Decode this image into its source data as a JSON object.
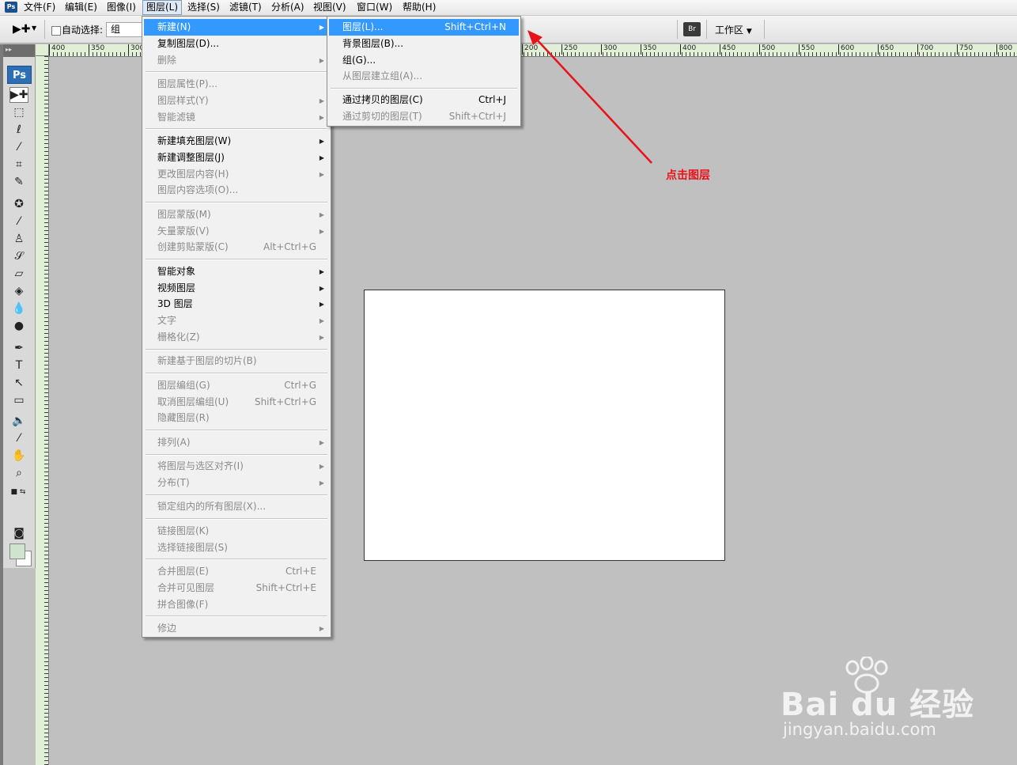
{
  "app": {
    "icon_label": "Ps"
  },
  "menubar": {
    "items": [
      "文件(F)",
      "编辑(E)",
      "图像(I)",
      "图层(L)",
      "选择(S)",
      "滤镜(T)",
      "分析(A)",
      "视图(V)",
      "窗口(W)",
      "帮助(H)"
    ],
    "active": "图层(L)"
  },
  "options_bar": {
    "auto_select_label": "自动选择:",
    "auto_select_checked": false,
    "auto_select_value": "组",
    "bridge_icon_label": "Br",
    "workspace_label": "工作区"
  },
  "toolbox": {
    "logo": "Ps"
  },
  "ruler": {
    "top_ticks": [
      "400",
      "350",
      "300",
      "200",
      "250",
      "300",
      "350",
      "400",
      "450",
      "500",
      "550",
      "600",
      "650",
      "700",
      "750",
      "800"
    ]
  },
  "layer_menu": {
    "items": [
      {
        "label": "新建(N)",
        "shortcut": "",
        "submenu": true,
        "enabled": true,
        "highlighted": true
      },
      {
        "label": "复制图层(D)...",
        "shortcut": "",
        "submenu": false,
        "enabled": true
      },
      {
        "label": "删除",
        "shortcut": "",
        "submenu": true,
        "enabled": false
      },
      {
        "separator": true
      },
      {
        "label": "图层属性(P)...",
        "shortcut": "",
        "submenu": false,
        "enabled": false
      },
      {
        "label": "图层样式(Y)",
        "shortcut": "",
        "submenu": true,
        "enabled": false
      },
      {
        "label": "智能滤镜",
        "shortcut": "",
        "submenu": true,
        "enabled": false
      },
      {
        "separator": true
      },
      {
        "label": "新建填充图层(W)",
        "shortcut": "",
        "submenu": true,
        "enabled": true
      },
      {
        "label": "新建调整图层(J)",
        "shortcut": "",
        "submenu": true,
        "enabled": true
      },
      {
        "label": "更改图层内容(H)",
        "shortcut": "",
        "submenu": true,
        "enabled": false
      },
      {
        "label": "图层内容选项(O)...",
        "shortcut": "",
        "submenu": false,
        "enabled": false
      },
      {
        "separator": true
      },
      {
        "label": "图层蒙版(M)",
        "shortcut": "",
        "submenu": true,
        "enabled": false
      },
      {
        "label": "矢量蒙版(V)",
        "shortcut": "",
        "submenu": true,
        "enabled": false
      },
      {
        "label": "创建剪贴蒙版(C)",
        "shortcut": "Alt+Ctrl+G",
        "submenu": false,
        "enabled": false
      },
      {
        "separator": true
      },
      {
        "label": "智能对象",
        "shortcut": "",
        "submenu": true,
        "enabled": true
      },
      {
        "label": "视频图层",
        "shortcut": "",
        "submenu": true,
        "enabled": true
      },
      {
        "label": "3D 图层",
        "shortcut": "",
        "submenu": true,
        "enabled": true
      },
      {
        "label": "文字",
        "shortcut": "",
        "submenu": true,
        "enabled": false
      },
      {
        "label": "栅格化(Z)",
        "shortcut": "",
        "submenu": true,
        "enabled": false
      },
      {
        "separator": true
      },
      {
        "label": "新建基于图层的切片(B)",
        "shortcut": "",
        "submenu": false,
        "enabled": false
      },
      {
        "separator": true
      },
      {
        "label": "图层编组(G)",
        "shortcut": "Ctrl+G",
        "submenu": false,
        "enabled": false
      },
      {
        "label": "取消图层编组(U)",
        "shortcut": "Shift+Ctrl+G",
        "submenu": false,
        "enabled": false
      },
      {
        "label": "隐藏图层(R)",
        "shortcut": "",
        "submenu": false,
        "enabled": false
      },
      {
        "separator": true
      },
      {
        "label": "排列(A)",
        "shortcut": "",
        "submenu": true,
        "enabled": false
      },
      {
        "separator": true
      },
      {
        "label": "将图层与选区对齐(I)",
        "shortcut": "",
        "submenu": true,
        "enabled": false
      },
      {
        "label": "分布(T)",
        "shortcut": "",
        "submenu": true,
        "enabled": false
      },
      {
        "separator": true
      },
      {
        "label": "锁定组内的所有图层(X)...",
        "shortcut": "",
        "submenu": false,
        "enabled": false
      },
      {
        "separator": true
      },
      {
        "label": "链接图层(K)",
        "shortcut": "",
        "submenu": false,
        "enabled": false
      },
      {
        "label": "选择链接图层(S)",
        "shortcut": "",
        "submenu": false,
        "enabled": false
      },
      {
        "separator": true
      },
      {
        "label": "合并图层(E)",
        "shortcut": "Ctrl+E",
        "submenu": false,
        "enabled": false
      },
      {
        "label": "合并可见图层",
        "shortcut": "Shift+Ctrl+E",
        "submenu": false,
        "enabled": false
      },
      {
        "label": "拼合图像(F)",
        "shortcut": "",
        "submenu": false,
        "enabled": false
      },
      {
        "separator": true
      },
      {
        "label": "修边",
        "shortcut": "",
        "submenu": true,
        "enabled": false
      }
    ]
  },
  "new_submenu": {
    "items": [
      {
        "label": "图层(L)...",
        "shortcut": "Shift+Ctrl+N",
        "enabled": true,
        "highlighted": true
      },
      {
        "label": "背景图层(B)...",
        "shortcut": "",
        "enabled": true
      },
      {
        "label": "组(G)...",
        "shortcut": "",
        "enabled": true
      },
      {
        "label": "从图层建立组(A)...",
        "shortcut": "",
        "enabled": false
      },
      {
        "separator": true
      },
      {
        "label": "通过拷贝的图层(C)",
        "shortcut": "Ctrl+J",
        "enabled": true
      },
      {
        "label": "通过剪切的图层(T)",
        "shortcut": "Shift+Ctrl+J",
        "enabled": false
      }
    ]
  },
  "annotation": {
    "text": "点击图层",
    "color": "#e8121b"
  },
  "watermark": {
    "logo": "Bai du 经验",
    "url": "jingyan.baidu.com"
  },
  "colors": {
    "highlight": "#3399ff",
    "ruler": "#e1efd6",
    "canvas_bg": "#c0c0c0",
    "foreground_swatch": "#cfe3cf"
  }
}
